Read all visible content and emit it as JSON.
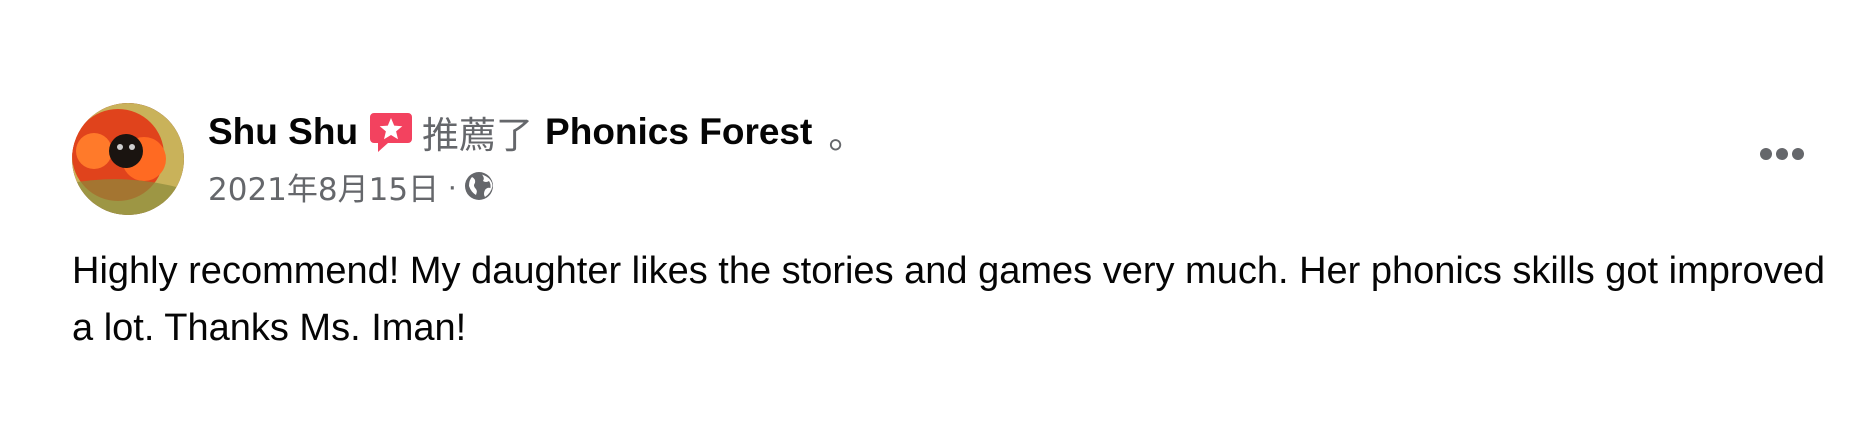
{
  "post": {
    "author": "Shu Shu",
    "recommend_verb": "推薦了",
    "page_name": "Phonics Forest",
    "trailing_mark": "。",
    "date": "2021年8月15日",
    "separator": "·",
    "privacy_icon": "globe-icon",
    "recommend_icon": "recommend-star-icon",
    "more_icon": "more-options-icon",
    "body": "Highly recommend! My daughter likes the stories and games very much. Her phonics skills got improved a lot. Thanks Ms. Iman!"
  },
  "colors": {
    "primary_text": "#050505",
    "secondary_text": "#65676b",
    "recommend_badge": "#f3425f",
    "background": "#ffffff"
  }
}
